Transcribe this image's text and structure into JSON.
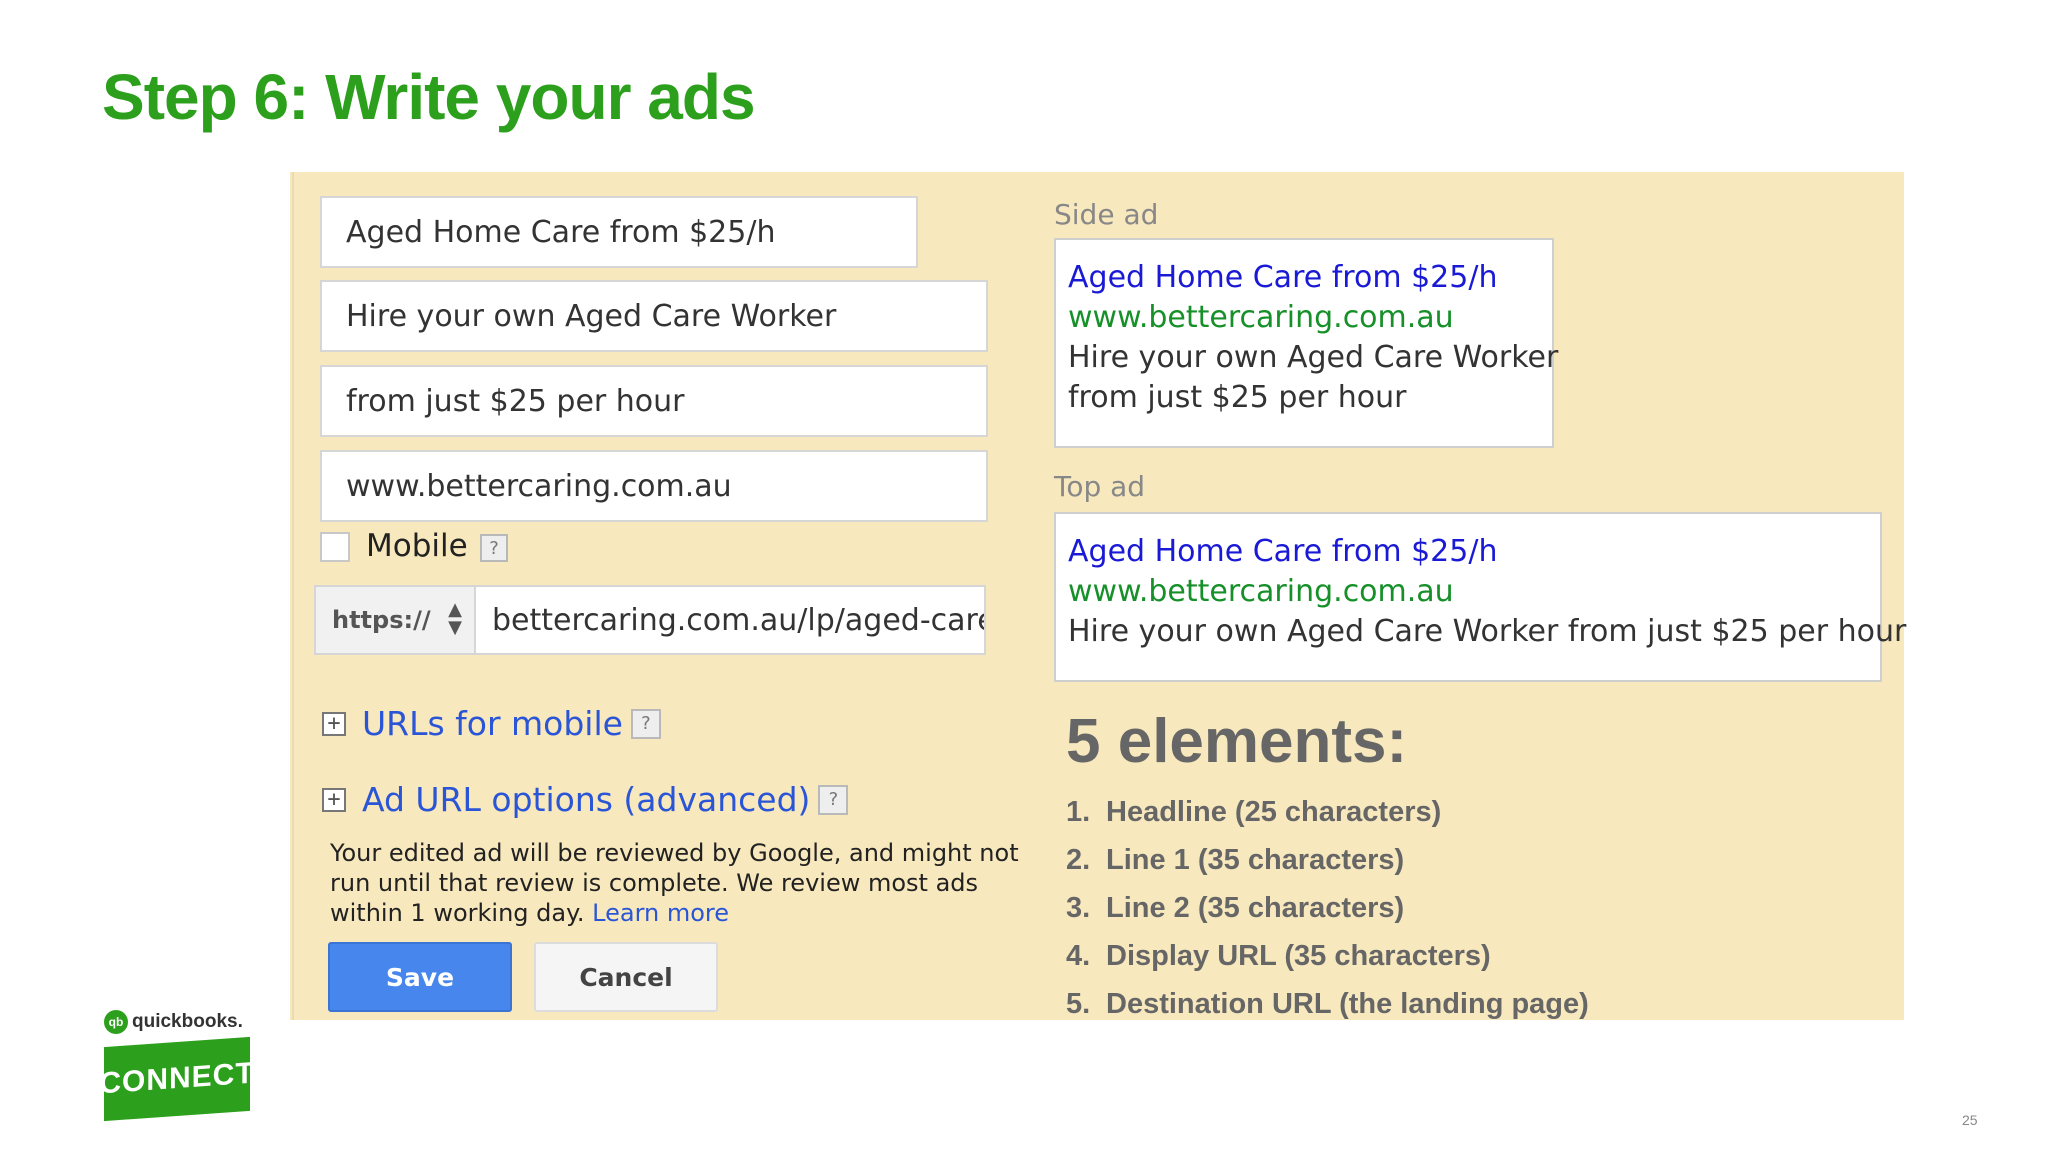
{
  "slide": {
    "title": "Step 6: Write your ads",
    "page_number": "25"
  },
  "form": {
    "headline": "Aged Home Care from $25/h",
    "line1": "Hire your own Aged Care Worker",
    "line2": "from just $25 per hour",
    "display_url": "www.bettercaring.com.au",
    "mobile_checked": false,
    "mobile_label": "Mobile",
    "help_glyph": "?",
    "protocol": "https://",
    "final_url": "bettercaring.com.au/lp/aged-care-w",
    "urls_for_mobile": "URLs for mobile",
    "ad_url_options": "Ad URL options (advanced)",
    "review_note": "Your edited ad will be reviewed by Google, and might not run until that review is complete. We review most ads within 1 working day.",
    "learn_more": "Learn more",
    "save_label": "Save",
    "cancel_label": "Cancel"
  },
  "preview": {
    "side_label": "Side ad",
    "top_label": "Top ad",
    "side_ad": {
      "headline": "Aged Home Care from $25/h",
      "url": "www.bettercaring.com.au",
      "line1": "Hire your own Aged Care Worker",
      "line2": "from just $25 per hour"
    },
    "top_ad": {
      "headline": "Aged Home Care from $25/h",
      "url": "www.bettercaring.com.au",
      "description": "Hire your own Aged Care Worker from just $25 per hour"
    }
  },
  "elements": {
    "title": "5 elements:",
    "items": [
      {
        "num": "1.",
        "text": "Headline (25 characters)"
      },
      {
        "num": "2.",
        "text": "Line 1 (35 characters)"
      },
      {
        "num": "3.",
        "text": "Line 2 (35 characters)"
      },
      {
        "num": "4.",
        "text": "Display URL (35 characters)"
      },
      {
        "num": "5.",
        "text": "Destination URL (the landing page)"
      }
    ]
  },
  "logo": {
    "qb_mark": "qb",
    "brand": "quickbooks.",
    "badge": "CONNECT"
  },
  "colors": {
    "title_green": "#2ca01c",
    "panel_bg": "#f8e8bd",
    "link_blue": "#2a55d6",
    "ad_headline_blue": "#1a1ad6",
    "ad_url_green": "#17902a",
    "save_blue": "#4787ed"
  },
  "icons": {
    "expander": "plus-square-icon",
    "protocol_selector": "up-down-arrows-icon",
    "help": "question-mark-icon"
  }
}
